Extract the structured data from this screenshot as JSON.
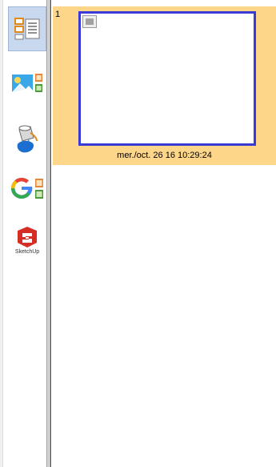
{
  "slides": [
    {
      "number": "1",
      "caption": "mer./oct. 26 16 10:29:24"
    }
  ],
  "toolbar": {
    "sketchup_label": "SketchUp"
  }
}
